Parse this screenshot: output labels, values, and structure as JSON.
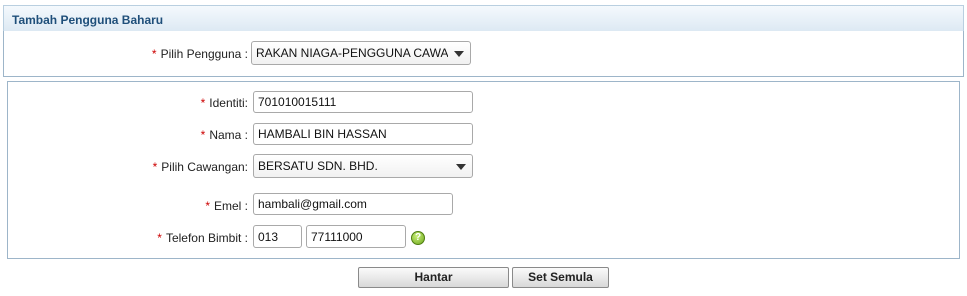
{
  "panel": {
    "title": "Tambah Pengguna Baharu"
  },
  "required_mark": "*",
  "pilih_pengguna": {
    "label": "Pilih Pengguna :",
    "value": "RAKAN NIAGA-PENGGUNA CAWANGAN"
  },
  "identiti": {
    "label": "Identiti:",
    "value": "701010015111"
  },
  "nama": {
    "label": "Nama :",
    "value": "HAMBALI BIN HASSAN"
  },
  "pilih_cawangan": {
    "label": "Pilih Cawangan:",
    "value": "BERSATU SDN. BHD."
  },
  "emel": {
    "label": "Emel :",
    "value": "hambali@gmail.com"
  },
  "telefon": {
    "label": "Telefon Bimbit :",
    "prefix": "013",
    "number": "77111000",
    "help_icon": "?"
  },
  "buttons": {
    "submit": "Hantar",
    "reset": "Set Semula"
  }
}
